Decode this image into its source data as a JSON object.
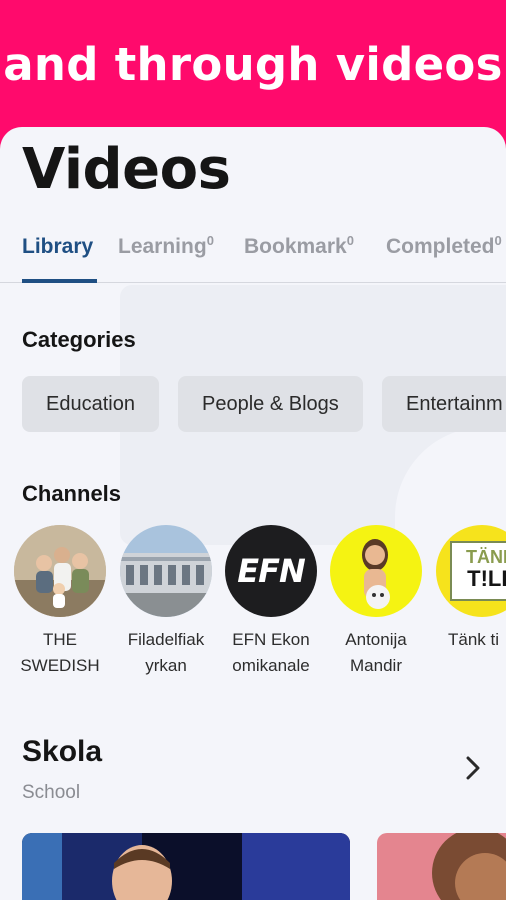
{
  "banner": {
    "text": "and through videos"
  },
  "page": {
    "title": "Videos"
  },
  "tabs": [
    {
      "label": "Library",
      "count": ""
    },
    {
      "label": "Learning",
      "count": "0"
    },
    {
      "label": "Bookmark",
      "count": "0"
    },
    {
      "label": "Completed",
      "count": "0"
    }
  ],
  "categories": {
    "title": "Categories",
    "items": [
      "Education",
      "People & Blogs",
      "Entertainm"
    ]
  },
  "channels": {
    "title": "Channels",
    "items": [
      {
        "line1": "THE",
        "line2": "SWEDISH"
      },
      {
        "line1": "Filadelfiak",
        "line2": "yrkan"
      },
      {
        "line1": "EFN Ekon",
        "line2": "omikanale",
        "logo": "EFN"
      },
      {
        "line1": "Antonija",
        "line2": "Mandir"
      },
      {
        "line1": "Tänk ti",
        "line2": "",
        "logo_line1": "TÄNK",
        "logo_line2": "T!LL"
      }
    ]
  },
  "section": {
    "title": "Skola",
    "subtitle": "School"
  },
  "colors": {
    "brand": "#ff0a6c",
    "accent": "#1f4f83",
    "background": "#f4f5fa"
  },
  "icons": {
    "section_more": "chevron-right-icon"
  }
}
